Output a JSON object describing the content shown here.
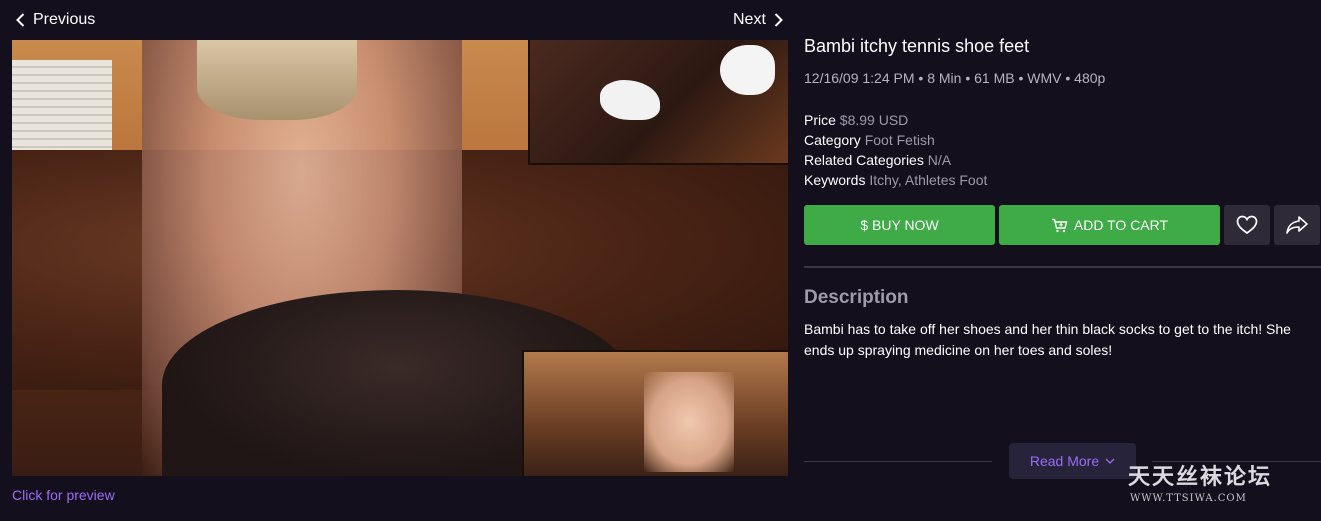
{
  "nav": {
    "prev_label": "Previous",
    "next_label": "Next"
  },
  "preview": {
    "caption": "Click for preview"
  },
  "product": {
    "title": "Bambi itchy tennis shoe feet",
    "meta": "12/16/09 1:24 PM • 8 Min • 61 MB • WMV • 480p",
    "details": [
      {
        "key": "Price",
        "value": "$8.99 USD"
      },
      {
        "key": "Category",
        "value": "Foot Fetish"
      },
      {
        "key": "Related Categories",
        "value": "N/A"
      },
      {
        "key": "Keywords",
        "value": "Itchy, Athletes Foot"
      }
    ]
  },
  "actions": {
    "buy_label": "$ BUY NOW",
    "cart_label": "ADD TO CART",
    "fav_icon": "heart-icon",
    "share_icon": "share-icon",
    "button_color": "#3fab47"
  },
  "description": {
    "heading": "Description",
    "body": "Bambi has to take off her shoes and her thin black socks to get to the itch! She ends up spraying medicine on her toes and soles!",
    "read_more_label": "Read More"
  },
  "watermark": {
    "main": "天天丝袜论坛",
    "sub": "WWW.TTSIWA.COM"
  },
  "colors": {
    "background": "#130f1d",
    "accent": "#9b6cf7"
  }
}
